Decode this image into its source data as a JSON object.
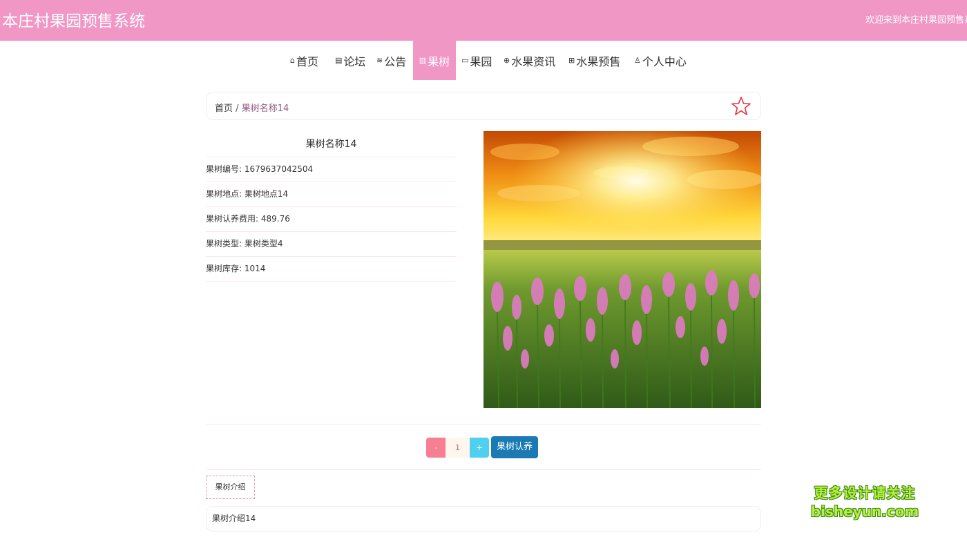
{
  "header": {
    "site_title": "本庄村果园预售系统",
    "welcome": "欢迎来到本庄村果园预售系统"
  },
  "nav": {
    "items": [
      {
        "label": "首页",
        "icon": "home-icon"
      },
      {
        "label": "论坛",
        "icon": "forum-icon"
      },
      {
        "label": "公告",
        "icon": "layers-icon"
      },
      {
        "label": "果树",
        "icon": "book-icon",
        "active": true
      },
      {
        "label": "果园",
        "icon": "printer-icon"
      },
      {
        "label": "水果资讯",
        "icon": "globe-icon"
      },
      {
        "label": "水果预售",
        "icon": "shop-icon"
      },
      {
        "label": "个人中心",
        "icon": "user-icon"
      }
    ]
  },
  "breadcrumb": {
    "home": "首页",
    "separator": "/",
    "current": "果树名称14"
  },
  "detail": {
    "title": "果树名称14",
    "rows": [
      {
        "label": "果树编号",
        "value": "1679637042504"
      },
      {
        "label": "果树地点",
        "value": "果树地点14"
      },
      {
        "label": "果树认养费用",
        "value": "489.76"
      },
      {
        "label": "果树类型",
        "value": "果树类型4"
      },
      {
        "label": "果树库存",
        "value": "1014"
      }
    ]
  },
  "actions": {
    "minus": "-",
    "quantity": "1",
    "plus": "+",
    "adopt": "果树认养"
  },
  "tabs": {
    "intro": "果树介绍"
  },
  "intro": {
    "text": "果树介绍14"
  },
  "watermark": {
    "line1": "更多设计请关注",
    "line2": "bisheyun.com"
  },
  "colors": {
    "header_pink": "#f097c6",
    "minus_red": "#f67f93",
    "plus_cyan": "#4fd0ee",
    "adopt_blue": "#1a7ab4",
    "star_red": "#e8303d"
  }
}
